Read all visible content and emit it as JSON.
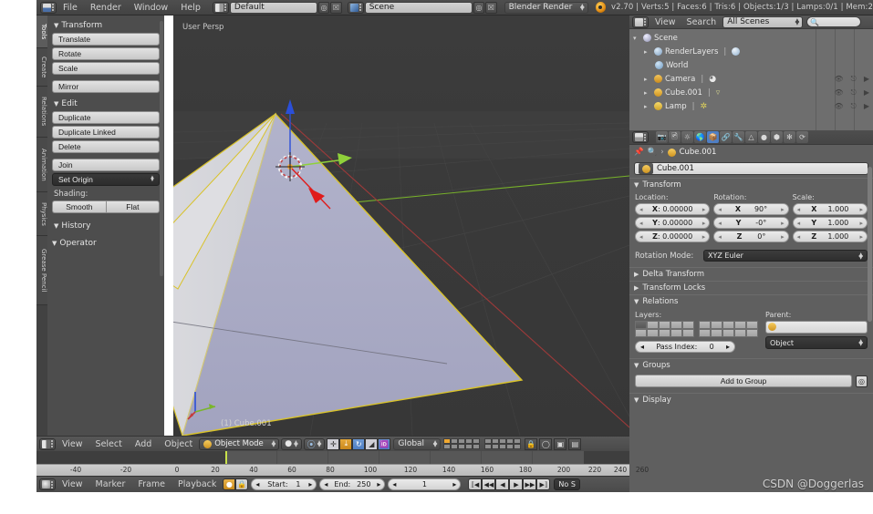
{
  "app": {
    "title": "Blender",
    "version_status": "v2.70 | Verts:5 | Faces:6 | Tris:6 | Objects:1/3 | Lamps:0/1 | Mem:2",
    "watermark": "CSDN @Doggerlas"
  },
  "topbar": {
    "menus": [
      "File",
      "Render",
      "Window",
      "Help"
    ],
    "screen_layout": "Default",
    "scene": "Scene",
    "render_engine": "Blender Render",
    "icons": {
      "editor_type": "editor-type-icon",
      "screen_add": "add-screen-icon",
      "screen_delete": "delete-screen-icon",
      "scene_icon": "scene-icon",
      "blender_logo": "blender-logo-icon"
    }
  },
  "tool_rail": {
    "tabs": [
      {
        "label": "Tools",
        "active": true
      },
      {
        "label": "Create",
        "active": false
      },
      {
        "label": "Relations",
        "active": false
      },
      {
        "label": "Animation",
        "active": false
      },
      {
        "label": "Physics",
        "active": false
      },
      {
        "label": "Grease Pencil",
        "active": false
      }
    ]
  },
  "tool_panel": {
    "sections": [
      {
        "title": "Transform",
        "expanded": true,
        "buttons": [
          "Translate",
          "Rotate",
          "Scale",
          "Mirror"
        ]
      },
      {
        "title": "Edit",
        "expanded": true,
        "buttons": [
          "Duplicate",
          "Duplicate Linked",
          "Delete",
          "Join"
        ],
        "dropdown": "Set Origin",
        "shading_label": "Shading:",
        "shading_buttons": [
          "Smooth",
          "Flat"
        ]
      },
      {
        "title": "History",
        "expanded": true,
        "buttons": []
      },
      {
        "title": "Operator",
        "expanded": true,
        "buttons": []
      }
    ]
  },
  "viewport": {
    "perspective": "User Persp",
    "object_label": "(1) Cube.001",
    "background": "#3a3a3a",
    "mesh_fill_front": "#a9aac4",
    "mesh_fill_side": "#d9dade",
    "selection_outline": "#d8c22a",
    "axis_x_color": "#a33a3a",
    "axis_y_color": "#7ab62a",
    "manipulator": {
      "z_color": "#2b4fd8",
      "y_color": "#8fd13a",
      "x_color": "#e01b1b"
    }
  },
  "viewport_header": {
    "menus": [
      "View",
      "Select",
      "Add",
      "Object"
    ],
    "mode": "Object Mode",
    "transform_orientation": "Global",
    "icons": [
      "editor-type-icon",
      "viewport-shading-icon",
      "pivot-point-icon",
      "snap-magnet-icon",
      "manipulator-translate-icon",
      "manipulator-rotate-icon",
      "manipulator-scale-icon",
      "render-region-icon",
      "lock-camera-icon",
      "proportional-edit-icon"
    ]
  },
  "outliner": {
    "menus": [
      "View",
      "Search"
    ],
    "display_mode": "All Scenes",
    "search_placeholder": "",
    "rows": [
      {
        "label": "Scene",
        "indent": 0,
        "color": "#c7c7d8",
        "expander": "▾",
        "restrict": false
      },
      {
        "label": "RenderLayers",
        "indent": 1,
        "color": "#b6c7d8",
        "expander": "▸",
        "restrict": false
      },
      {
        "label": "World",
        "indent": 1,
        "color": "#9fc0da",
        "expander": "",
        "restrict": false
      },
      {
        "label": "Camera",
        "indent": 1,
        "color": "#e0a23a",
        "expander": "▸",
        "restrict": true
      },
      {
        "label": "Cube.001",
        "indent": 1,
        "color": "#e8b43c",
        "expander": "▸",
        "restrict": true
      },
      {
        "label": "Lamp",
        "indent": 1,
        "color": "#e5c64a",
        "expander": "▸",
        "restrict": true
      }
    ],
    "restrict_icons": [
      "eye-icon",
      "cursor-select-icon",
      "render-camera-icon"
    ]
  },
  "properties": {
    "tabs": [
      {
        "name": "render-tab",
        "glyph": "▣",
        "active": false
      },
      {
        "name": "render-layers-tab",
        "glyph": "⬚",
        "active": false
      },
      {
        "name": "scene-tab",
        "glyph": "◐",
        "active": false
      },
      {
        "name": "world-tab",
        "glyph": "●",
        "active": false
      },
      {
        "name": "object-tab",
        "glyph": "■",
        "active": true
      },
      {
        "name": "constraints-tab",
        "glyph": "⛓",
        "active": false
      },
      {
        "name": "modifiers-tab",
        "glyph": "ὒ7",
        "active": false
      },
      {
        "name": "data-tab",
        "glyph": "▽",
        "active": false
      },
      {
        "name": "material-tab",
        "glyph": "○",
        "active": false
      },
      {
        "name": "texture-tab",
        "glyph": "⬢",
        "active": false
      },
      {
        "name": "particles-tab",
        "glyph": "⁂",
        "active": false
      },
      {
        "name": "physics-tab",
        "glyph": "⟳",
        "active": false
      }
    ],
    "breadcrumb": "Cube.001",
    "object_name": "Cube.001",
    "transform": {
      "title": "Transform",
      "location_label": "Location:",
      "rotation_label": "Rotation:",
      "scale_label": "Scale:",
      "location": [
        {
          "axis": "X",
          "value": "0.00000"
        },
        {
          "axis": "Y",
          "value": "0.00000"
        },
        {
          "axis": "Z",
          "value": "0.00000"
        }
      ],
      "rotation": [
        {
          "axis": "X",
          "value": "90°"
        },
        {
          "axis": "Y",
          "value": "-0°"
        },
        {
          "axis": "Z",
          "value": "0°"
        }
      ],
      "scale": [
        {
          "axis": "X",
          "value": "1.000"
        },
        {
          "axis": "Y",
          "value": "1.000"
        },
        {
          "axis": "Z",
          "value": "1.000"
        }
      ],
      "rotation_mode_label": "Rotation Mode:",
      "rotation_mode_value": "XYZ Euler"
    },
    "collapsed_sections": [
      "Delta Transform",
      "Transform Locks"
    ],
    "relations": {
      "title": "Relations",
      "layers_label": "Layers:",
      "parent_label": "Parent:",
      "parent_value": "",
      "parent_type": "Object",
      "pass_index_label": "Pass Index:",
      "pass_index_value": "0"
    },
    "groups": {
      "title": "Groups",
      "add_button": "Add to Group"
    },
    "display": {
      "title": "Display"
    }
  },
  "timeline": {
    "menus": [
      "View",
      "Marker",
      "Frame",
      "Playback"
    ],
    "start_label": "Start:",
    "start_value": "1",
    "end_label": "End:",
    "end_value": "250",
    "current_frame": "1",
    "sync_mode": "No S",
    "ruler_ticks": [
      "-40",
      "-20",
      "0",
      "20",
      "40",
      "60",
      "80",
      "100",
      "120",
      "140",
      "160",
      "180",
      "200",
      "220",
      "240",
      "260"
    ],
    "playback_buttons": [
      "jump-start-icon",
      "prev-keyframe-icon",
      "play-reverse-icon",
      "play-icon",
      "next-keyframe-icon",
      "jump-end-icon"
    ]
  }
}
